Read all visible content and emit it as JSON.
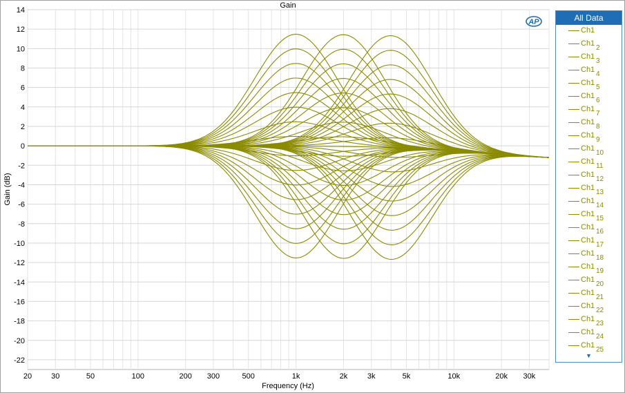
{
  "chart_data": {
    "type": "line",
    "title": "Gain",
    "xlabel": "Frequency (Hz)",
    "ylabel": "Gain (dB)",
    "x_scale": "log",
    "xlim": [
      20,
      40000
    ],
    "ylim": [
      -23,
      14
    ],
    "grid": true,
    "x_ticks": [
      {
        "value": 20,
        "label": "20"
      },
      {
        "value": 30,
        "label": "30"
      },
      {
        "value": 50,
        "label": "50"
      },
      {
        "value": 100,
        "label": "100"
      },
      {
        "value": 200,
        "label": "200"
      },
      {
        "value": 300,
        "label": "300"
      },
      {
        "value": 500,
        "label": "500"
      },
      {
        "value": 1000,
        "label": "1k"
      },
      {
        "value": 2000,
        "label": "2k"
      },
      {
        "value": 3000,
        "label": "3k"
      },
      {
        "value": 5000,
        "label": "5k"
      },
      {
        "value": 10000,
        "label": "10k"
      },
      {
        "value": 20000,
        "label": "20k"
      },
      {
        "value": 30000,
        "label": "30k"
      }
    ],
    "y_ticks": [
      14,
      12,
      10,
      8,
      6,
      4,
      2,
      0,
      -2,
      -4,
      -6,
      -8,
      -10,
      -12,
      -14,
      -16,
      -18,
      -20,
      -22
    ],
    "line_color": "#8b8b00",
    "series_note": "Parametric EQ sweep family: peaking curves at ~1k, 2k and 4k with boost/cut between 0 and ±11.5 dB, converging to about -1.6 dB at 40 kHz",
    "series_family": {
      "centers_hz": [
        1000,
        2000,
        4000
      ],
      "gains_db": [
        11.5,
        10,
        8.5,
        7,
        5.5,
        4,
        2.5,
        1,
        -1,
        -2.5,
        -4,
        -5.5,
        -7,
        -8.5,
        -10,
        -11.5
      ],
      "end_db_at_40k": -1.6
    }
  },
  "legend": {
    "header": "All Data",
    "items": [
      {
        "name": "Ch1",
        "num": ""
      },
      {
        "name": "Ch1",
        "num": "2"
      },
      {
        "name": "Ch1",
        "num": "3"
      },
      {
        "name": "Ch1",
        "num": "4"
      },
      {
        "name": "Ch1",
        "num": "5"
      },
      {
        "name": "Ch1",
        "num": "6"
      },
      {
        "name": "Ch1",
        "num": "7"
      },
      {
        "name": "Ch1",
        "num": "8"
      },
      {
        "name": "Ch1",
        "num": "9"
      },
      {
        "name": "Ch1",
        "num": "10"
      },
      {
        "name": "Ch1",
        "num": "11"
      },
      {
        "name": "Ch1",
        "num": "12"
      },
      {
        "name": "Ch1",
        "num": "13"
      },
      {
        "name": "Ch1",
        "num": "14"
      },
      {
        "name": "Ch1",
        "num": "15"
      },
      {
        "name": "Ch1",
        "num": "16"
      },
      {
        "name": "Ch1",
        "num": "17"
      },
      {
        "name": "Ch1",
        "num": "18"
      },
      {
        "name": "Ch1",
        "num": "19"
      },
      {
        "name": "Ch1",
        "num": "20"
      },
      {
        "name": "Ch1",
        "num": "21"
      },
      {
        "name": "Ch1",
        "num": "22"
      },
      {
        "name": "Ch1",
        "num": "23"
      },
      {
        "name": "Ch1",
        "num": "24"
      },
      {
        "name": "Ch1",
        "num": "25"
      }
    ],
    "scroll_icon": "triangle-down-icon"
  },
  "logo": {
    "text": "AP",
    "icon": "ap-logo-icon",
    "color": "#1f6db5"
  }
}
